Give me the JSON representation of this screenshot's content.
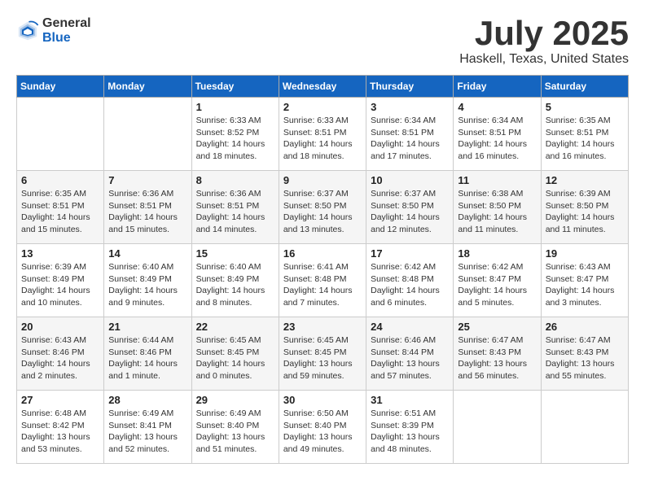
{
  "header": {
    "logo_general": "General",
    "logo_blue": "Blue",
    "title": "July 2025",
    "subtitle": "Haskell, Texas, United States"
  },
  "columns": [
    "Sunday",
    "Monday",
    "Tuesday",
    "Wednesday",
    "Thursday",
    "Friday",
    "Saturday"
  ],
  "weeks": [
    [
      {
        "day": "",
        "detail": ""
      },
      {
        "day": "",
        "detail": ""
      },
      {
        "day": "1",
        "detail": "Sunrise: 6:33 AM\nSunset: 8:52 PM\nDaylight: 14 hours and 18 minutes."
      },
      {
        "day": "2",
        "detail": "Sunrise: 6:33 AM\nSunset: 8:51 PM\nDaylight: 14 hours and 18 minutes."
      },
      {
        "day": "3",
        "detail": "Sunrise: 6:34 AM\nSunset: 8:51 PM\nDaylight: 14 hours and 17 minutes."
      },
      {
        "day": "4",
        "detail": "Sunrise: 6:34 AM\nSunset: 8:51 PM\nDaylight: 14 hours and 16 minutes."
      },
      {
        "day": "5",
        "detail": "Sunrise: 6:35 AM\nSunset: 8:51 PM\nDaylight: 14 hours and 16 minutes."
      }
    ],
    [
      {
        "day": "6",
        "detail": "Sunrise: 6:35 AM\nSunset: 8:51 PM\nDaylight: 14 hours and 15 minutes."
      },
      {
        "day": "7",
        "detail": "Sunrise: 6:36 AM\nSunset: 8:51 PM\nDaylight: 14 hours and 15 minutes."
      },
      {
        "day": "8",
        "detail": "Sunrise: 6:36 AM\nSunset: 8:51 PM\nDaylight: 14 hours and 14 minutes."
      },
      {
        "day": "9",
        "detail": "Sunrise: 6:37 AM\nSunset: 8:50 PM\nDaylight: 14 hours and 13 minutes."
      },
      {
        "day": "10",
        "detail": "Sunrise: 6:37 AM\nSunset: 8:50 PM\nDaylight: 14 hours and 12 minutes."
      },
      {
        "day": "11",
        "detail": "Sunrise: 6:38 AM\nSunset: 8:50 PM\nDaylight: 14 hours and 11 minutes."
      },
      {
        "day": "12",
        "detail": "Sunrise: 6:39 AM\nSunset: 8:50 PM\nDaylight: 14 hours and 11 minutes."
      }
    ],
    [
      {
        "day": "13",
        "detail": "Sunrise: 6:39 AM\nSunset: 8:49 PM\nDaylight: 14 hours and 10 minutes."
      },
      {
        "day": "14",
        "detail": "Sunrise: 6:40 AM\nSunset: 8:49 PM\nDaylight: 14 hours and 9 minutes."
      },
      {
        "day": "15",
        "detail": "Sunrise: 6:40 AM\nSunset: 8:49 PM\nDaylight: 14 hours and 8 minutes."
      },
      {
        "day": "16",
        "detail": "Sunrise: 6:41 AM\nSunset: 8:48 PM\nDaylight: 14 hours and 7 minutes."
      },
      {
        "day": "17",
        "detail": "Sunrise: 6:42 AM\nSunset: 8:48 PM\nDaylight: 14 hours and 6 minutes."
      },
      {
        "day": "18",
        "detail": "Sunrise: 6:42 AM\nSunset: 8:47 PM\nDaylight: 14 hours and 5 minutes."
      },
      {
        "day": "19",
        "detail": "Sunrise: 6:43 AM\nSunset: 8:47 PM\nDaylight: 14 hours and 3 minutes."
      }
    ],
    [
      {
        "day": "20",
        "detail": "Sunrise: 6:43 AM\nSunset: 8:46 PM\nDaylight: 14 hours and 2 minutes."
      },
      {
        "day": "21",
        "detail": "Sunrise: 6:44 AM\nSunset: 8:46 PM\nDaylight: 14 hours and 1 minute."
      },
      {
        "day": "22",
        "detail": "Sunrise: 6:45 AM\nSunset: 8:45 PM\nDaylight: 14 hours and 0 minutes."
      },
      {
        "day": "23",
        "detail": "Sunrise: 6:45 AM\nSunset: 8:45 PM\nDaylight: 13 hours and 59 minutes."
      },
      {
        "day": "24",
        "detail": "Sunrise: 6:46 AM\nSunset: 8:44 PM\nDaylight: 13 hours and 57 minutes."
      },
      {
        "day": "25",
        "detail": "Sunrise: 6:47 AM\nSunset: 8:43 PM\nDaylight: 13 hours and 56 minutes."
      },
      {
        "day": "26",
        "detail": "Sunrise: 6:47 AM\nSunset: 8:43 PM\nDaylight: 13 hours and 55 minutes."
      }
    ],
    [
      {
        "day": "27",
        "detail": "Sunrise: 6:48 AM\nSunset: 8:42 PM\nDaylight: 13 hours and 53 minutes."
      },
      {
        "day": "28",
        "detail": "Sunrise: 6:49 AM\nSunset: 8:41 PM\nDaylight: 13 hours and 52 minutes."
      },
      {
        "day": "29",
        "detail": "Sunrise: 6:49 AM\nSunset: 8:40 PM\nDaylight: 13 hours and 51 minutes."
      },
      {
        "day": "30",
        "detail": "Sunrise: 6:50 AM\nSunset: 8:40 PM\nDaylight: 13 hours and 49 minutes."
      },
      {
        "day": "31",
        "detail": "Sunrise: 6:51 AM\nSunset: 8:39 PM\nDaylight: 13 hours and 48 minutes."
      },
      {
        "day": "",
        "detail": ""
      },
      {
        "day": "",
        "detail": ""
      }
    ]
  ]
}
